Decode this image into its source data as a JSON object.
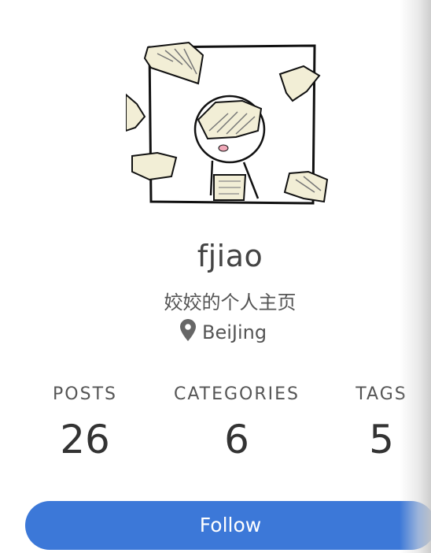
{
  "author": {
    "name": "fjiao",
    "description": "姣姣的个人主页",
    "location": "BeiJing",
    "location_icon": "map-marker-icon",
    "avatar_icon": "cartoon-avatar-icon"
  },
  "stats": [
    {
      "label": "POSTS",
      "count": "26"
    },
    {
      "label": "CATEGORIES",
      "count": "6"
    },
    {
      "label": "TAGS",
      "count": "5"
    }
  ],
  "follow": {
    "label": "Follow",
    "color": "#3c78d8"
  }
}
